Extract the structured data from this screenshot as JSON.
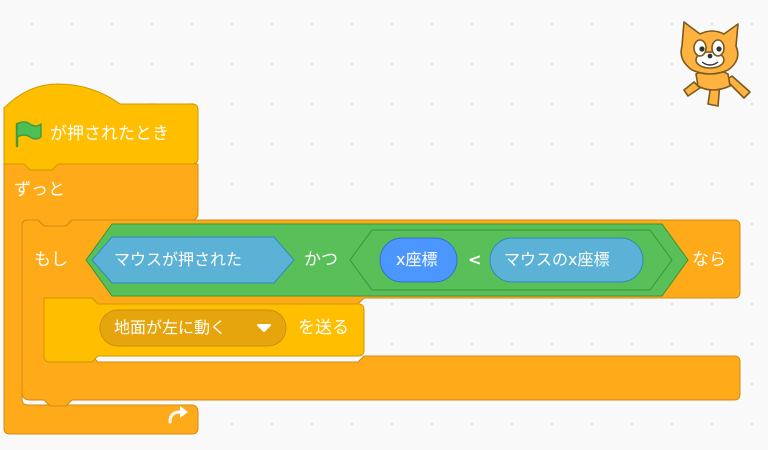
{
  "colors": {
    "control": "#ffab19",
    "control_dark": "#cf8b17",
    "events": "#ffbf00",
    "operators": "#59c059",
    "operators_dark": "#389438",
    "sensing": "#5cb1d6",
    "sensing_dark": "#2e8eb8",
    "motion": "#4c97ff",
    "motion_dark": "#3373cc"
  },
  "hat_block": {
    "flag_icon": "green-flag-icon",
    "label": "が押されたとき"
  },
  "forever_block": {
    "label": "ずっと",
    "loop_icon": "repeat-arrow-icon"
  },
  "if_block": {
    "if_label": "もし",
    "then_label": "なら"
  },
  "and_operator": {
    "label": "かつ"
  },
  "mouse_down_reporter": {
    "label": "マウスが押された"
  },
  "less_than_operator": {
    "symbol": "<"
  },
  "x_position_reporter": {
    "label": "x座標"
  },
  "mouse_x_reporter": {
    "label": "マウスのx座標"
  },
  "broadcast_block": {
    "message": "地面が左に動く",
    "label": "を送る",
    "dropdown_icon": "caret-down-icon"
  },
  "sprite": {
    "icon": "scratch-cat-icon"
  }
}
